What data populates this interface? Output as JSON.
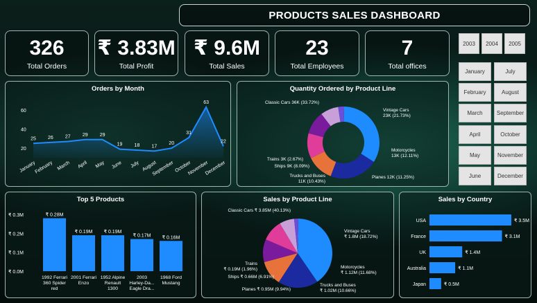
{
  "header": {
    "title": "PRODUCTS SALES DASHBOARD"
  },
  "kpis": [
    {
      "value": "326",
      "label": "Total Orders"
    },
    {
      "value": "₹ 3.83M",
      "label": "Total Profit"
    },
    {
      "value": "₹ 9.6M",
      "label": "Total Sales"
    },
    {
      "value": "23",
      "label": "Total Employees"
    },
    {
      "value": "7",
      "label": "Total offices"
    }
  ],
  "filters": {
    "years": [
      "2003",
      "2004",
      "2005"
    ],
    "months": [
      "January",
      "July",
      "February",
      "August",
      "March",
      "September",
      "April",
      "October",
      "May",
      "November",
      "June",
      "December"
    ]
  },
  "colors": {
    "accent": "#1e8bff",
    "navy": "#1b2a9e",
    "orange": "#e8733a",
    "pink": "#e03d9a",
    "purple": "#7a1b9e",
    "lavender": "#c89fd8",
    "violet": "#6a4fd8"
  },
  "chart_data": [
    {
      "type": "area",
      "title": "Orders by Month",
      "categories": [
        "January",
        "February",
        "March",
        "April",
        "May",
        "June",
        "July",
        "August",
        "September",
        "October",
        "November",
        "December"
      ],
      "values": [
        25,
        26,
        27,
        29,
        29,
        19,
        18,
        17,
        20,
        31,
        63,
        22
      ],
      "ytick_labels": [
        "20",
        "40",
        "60"
      ],
      "ylim": [
        10,
        68
      ]
    },
    {
      "type": "pie",
      "title": "Quantity Ordered by Product Line",
      "donut": true,
      "slices": [
        {
          "label": "Classic Cars 36K (33.72%)",
          "value": 33.72,
          "color": "#1e8bff"
        },
        {
          "label": "Vintage Cars 23K (21.73%)",
          "value": 21.73,
          "color": "#1b2a9e"
        },
        {
          "label": "Motorcycles 13K (12.11%)",
          "value": 12.11,
          "color": "#e8733a"
        },
        {
          "label": "Planes 12K (11.25%)",
          "value": 11.25,
          "color": "#e03d9a"
        },
        {
          "label": "Trucks and Buses 11K (10.43%)",
          "value": 10.43,
          "color": "#7a1b9e"
        },
        {
          "label": "Ships 9K (8.09%)",
          "value": 8.09,
          "color": "#c89fd8"
        },
        {
          "label": "Trains 3K (2.67%)",
          "value": 2.67,
          "color": "#6a4fd8"
        }
      ]
    },
    {
      "type": "bar",
      "title": "Top 5 Products",
      "categories": [
        "1992 Ferrari 360 Spider red",
        "2001 Ferrari Enzo",
        "1952 Alpine Renault 1300",
        "2003 Harley-Da... Eagle Dra...",
        "1968 Ford Mustang"
      ],
      "values": [
        0.28,
        0.19,
        0.19,
        0.17,
        0.16
      ],
      "data_labels": [
        "₹ 0.28M",
        "₹ 0.19M",
        "₹ 0.19M",
        "₹ 0.17M",
        "₹ 0.16M"
      ],
      "ytick_labels": [
        "₹ 0.0M",
        "₹ 0.1M",
        "₹ 0.2M",
        "₹ 0.3M"
      ],
      "ylim": [
        0,
        0.3
      ]
    },
    {
      "type": "pie",
      "title": "Sales by Product Line",
      "slices": [
        {
          "label": "Classic Cars ₹ 3.85M (40.13%)",
          "value": 40.13,
          "color": "#1e8bff"
        },
        {
          "label": "Vintage Cars ₹ 1.8M (18.72%)",
          "value": 18.72,
          "color": "#1b2a9e"
        },
        {
          "label": "Motorcycles ₹ 1.12M (11.68%)",
          "value": 11.68,
          "color": "#e8733a"
        },
        {
          "label": "Trucks and Buses ₹ 1.02M (10.66%)",
          "value": 10.66,
          "color": "#7a1b9e"
        },
        {
          "label": "Planes ₹ 0.95M (9.94%)",
          "value": 9.94,
          "color": "#e03d9a"
        },
        {
          "label": "Ships ₹ 0.66M (6.91%)",
          "value": 6.91,
          "color": "#c89fd8"
        },
        {
          "label": "Trains ₹ 0.19M (1.96%)",
          "value": 1.96,
          "color": "#6a4fd8"
        }
      ]
    },
    {
      "type": "bar",
      "orientation": "horizontal",
      "title": "Sales by Country",
      "categories": [
        "USA",
        "France",
        "UK",
        "Australia",
        "Japan"
      ],
      "values": [
        3.5,
        3.1,
        1.4,
        1.1,
        0.5
      ],
      "data_labels": [
        "₹ 3.5M",
        "₹ 3.1M",
        "₹ 1.4M",
        "₹ 1.1M",
        "₹ 0.5M"
      ]
    }
  ]
}
